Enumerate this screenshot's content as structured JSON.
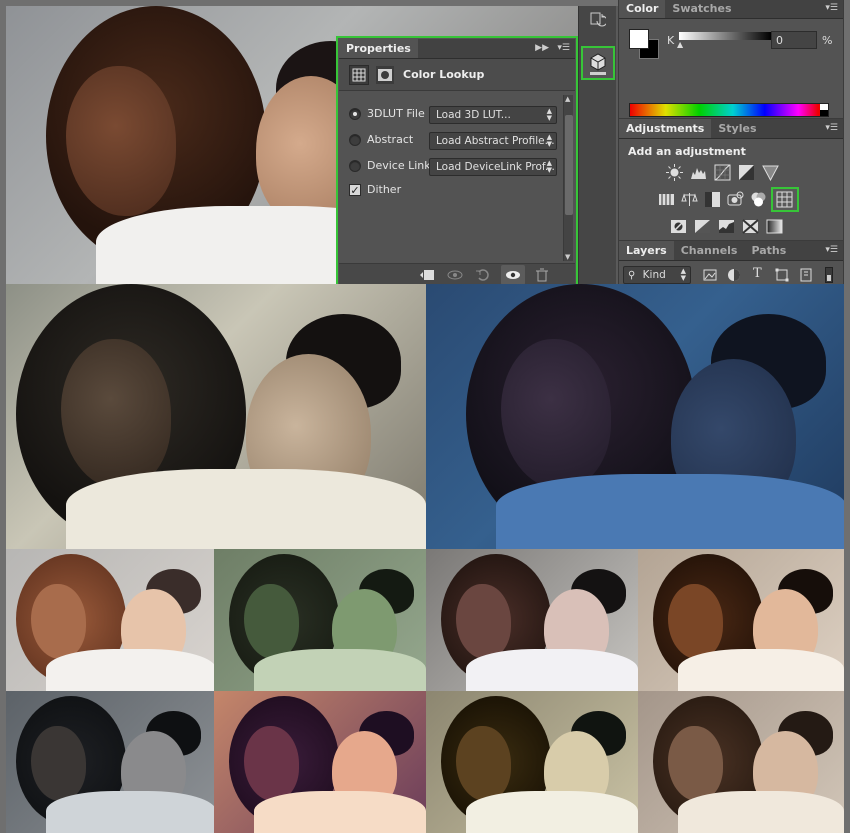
{
  "properties_panel": {
    "tab_label": "Properties",
    "title": "Color Lookup",
    "rows": [
      {
        "label": "3DLUT File",
        "dropdown": "Load 3D LUT...",
        "selected": true
      },
      {
        "label": "Abstract",
        "dropdown": "Load Abstract Profile...",
        "selected": false
      },
      {
        "label": "Device Link",
        "dropdown": "Load DeviceLink Prof...",
        "selected": false
      }
    ],
    "dither_label": "Dither",
    "dither_checked": true
  },
  "color_panel": {
    "tabs": [
      "Color",
      "Swatches"
    ],
    "channel_label": "K",
    "value": "0",
    "unit": "%"
  },
  "adjustments_panel": {
    "tabs": [
      "Adjustments",
      "Styles"
    ],
    "heading": "Add an adjustment"
  },
  "layers_panel": {
    "tabs": [
      "Layers",
      "Channels",
      "Paths"
    ],
    "filter_kind": "Kind"
  },
  "colors": {
    "highlight": "#37c538",
    "panel_bg": "#535353",
    "tab_bar_bg": "#424242"
  },
  "icons": [
    "menu-icon",
    "double-arrow-icon",
    "history-icon",
    "3d-icon",
    "grid-icon",
    "mask-icon",
    "brightness-icon",
    "levels-icon",
    "curves-icon",
    "exposure-icon",
    "vibrance-icon",
    "hue-sat-icon",
    "color-balance-icon",
    "black-white-icon",
    "photo-filter-icon",
    "channel-mixer-icon",
    "color-lookup-icon",
    "invert-icon",
    "posterize-icon",
    "threshold-icon",
    "selective-color-icon",
    "gradient-map-icon",
    "clip-icon",
    "view-previous-icon",
    "reset-icon",
    "visibility-icon",
    "trash-icon",
    "search-icon"
  ]
}
